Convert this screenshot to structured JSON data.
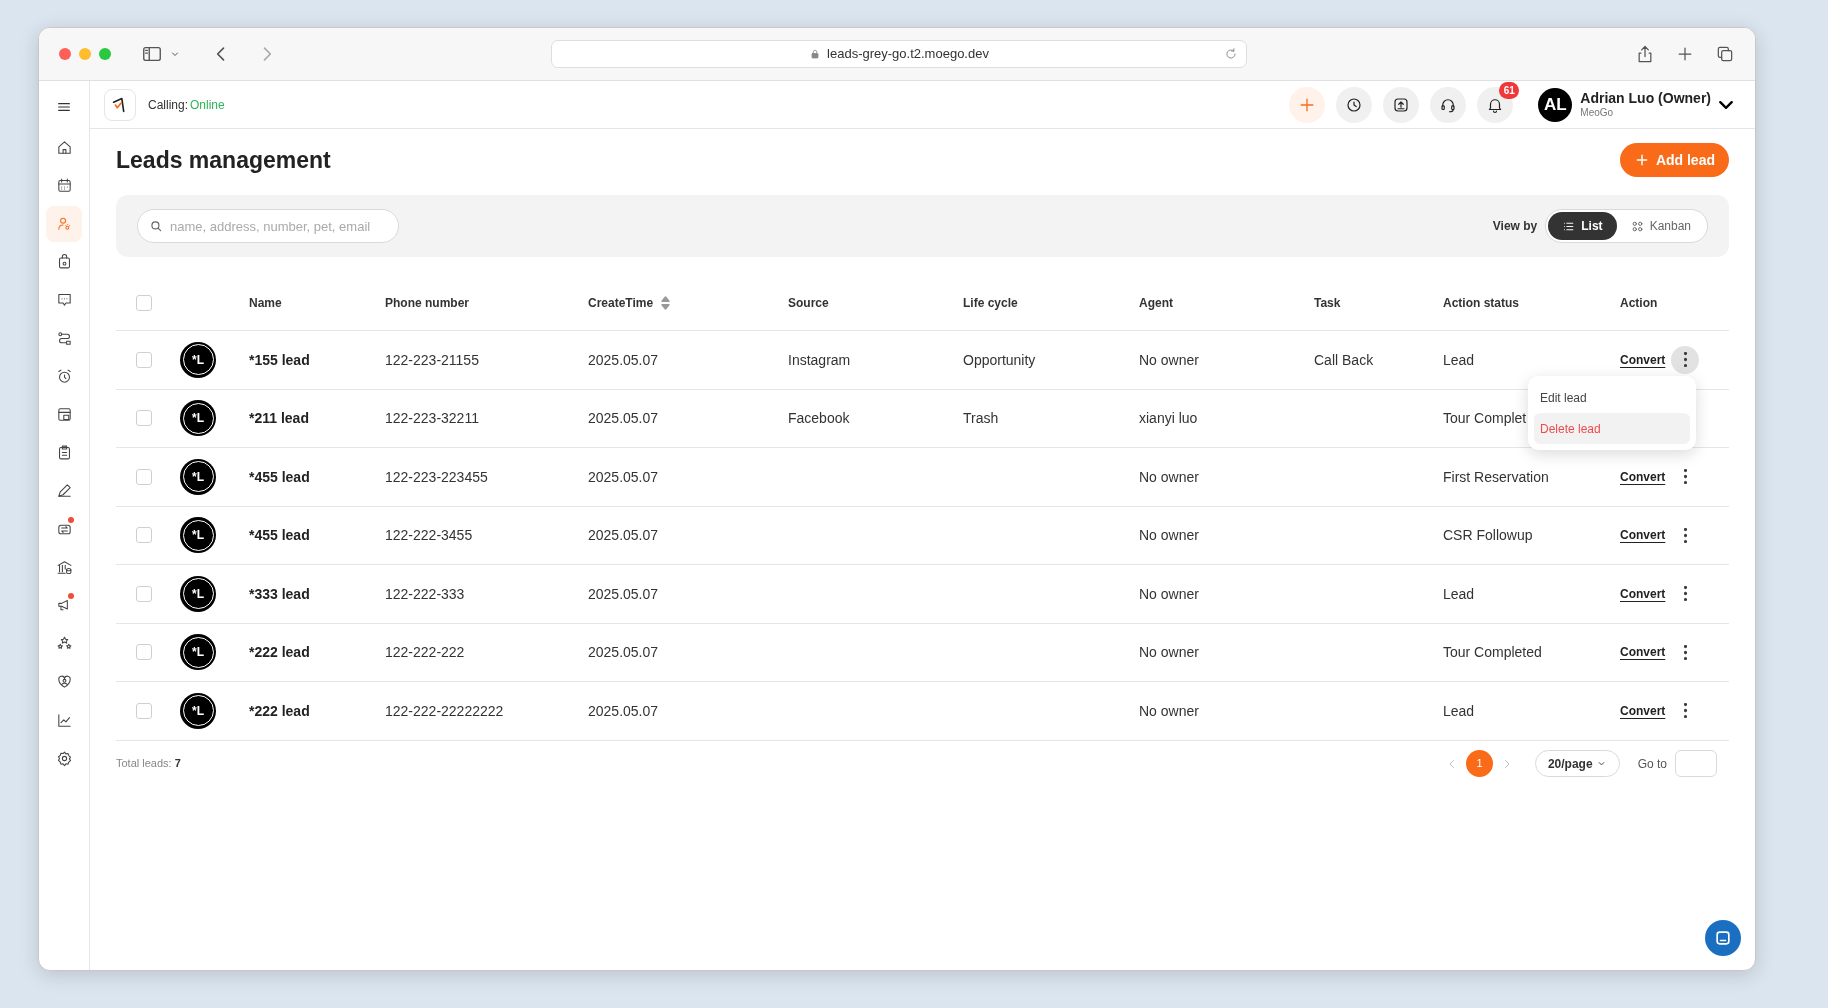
{
  "browser": {
    "url": "leads-grey-go.t2.moego.dev"
  },
  "topbar": {
    "calling_label": "Calling:",
    "calling_status": "Online",
    "notification_count": "61",
    "user": {
      "initials": "AL",
      "name": "Adrian Luo (Owner)",
      "company": "MeoGo"
    }
  },
  "sidebar": {
    "items": [
      {
        "selected": false,
        "dot": false
      },
      {
        "selected": false,
        "dot": false
      },
      {
        "selected": true,
        "dot": false
      },
      {
        "selected": false,
        "dot": false
      },
      {
        "selected": false,
        "dot": false
      },
      {
        "selected": false,
        "dot": false
      },
      {
        "selected": false,
        "dot": false
      },
      {
        "selected": false,
        "dot": false
      },
      {
        "selected": false,
        "dot": false
      },
      {
        "selected": false,
        "dot": false
      },
      {
        "selected": false,
        "dot": true
      },
      {
        "selected": false,
        "dot": false
      },
      {
        "selected": false,
        "dot": true
      },
      {
        "selected": false,
        "dot": false
      },
      {
        "selected": false,
        "dot": false
      },
      {
        "selected": false,
        "dot": false
      },
      {
        "selected": false,
        "dot": false
      }
    ]
  },
  "page": {
    "title": "Leads management",
    "add_button": "Add lead",
    "search": {
      "placeholder": "name, address, number, pet, email"
    },
    "view_by": {
      "label": "View by",
      "options": [
        {
          "label": "List",
          "selected": true
        },
        {
          "label": "Kanban",
          "selected": false
        }
      ]
    }
  },
  "table": {
    "select_all_checked": false,
    "columns": [
      {
        "label": "Name"
      },
      {
        "label": "Phone number"
      },
      {
        "label": "CreateTime",
        "sortable": true
      },
      {
        "label": "Source"
      },
      {
        "label": "Life cycle"
      },
      {
        "label": "Agent"
      },
      {
        "label": "Task"
      },
      {
        "label": "Action status"
      },
      {
        "label": "Action"
      }
    ],
    "rows": [
      {
        "checked": false,
        "avatar": "*L",
        "name": "*155 lead",
        "phone": "122-223-21155",
        "create_time": "2025.05.07",
        "source": "Instagram",
        "life_cycle": "Opportunity",
        "agent": "No owner",
        "task": "Call Back",
        "action_status": "Lead",
        "action": "Convert",
        "menu_open": true
      },
      {
        "checked": false,
        "avatar": "*L",
        "name": "*211 lead",
        "phone": "122-223-32211",
        "create_time": "2025.05.07",
        "source": "Facebook",
        "life_cycle": "Trash",
        "agent": "xianyi luo",
        "action_status": "Tour Complet"
      },
      {
        "checked": false,
        "avatar": "*L",
        "name": "*455 lead",
        "phone": "122-223-223455",
        "create_time": "2025.05.07",
        "agent": "No owner",
        "action_status": "First Reservation",
        "action": "Convert",
        "menu_open": false
      },
      {
        "checked": false,
        "avatar": "*L",
        "name": "*455 lead",
        "phone": "122-222-3455",
        "create_time": "2025.05.07",
        "agent": "No owner",
        "action_status": "CSR Followup",
        "action": "Convert",
        "menu_open": false
      },
      {
        "checked": false,
        "avatar": "*L",
        "name": "*333 lead",
        "phone": "122-222-333",
        "create_time": "2025.05.07",
        "agent": "No owner",
        "action_status": "Lead",
        "action": "Convert",
        "menu_open": false
      },
      {
        "checked": false,
        "avatar": "*L",
        "name": "*222 lead",
        "phone": "122-222-222",
        "create_time": "2025.05.07",
        "agent": "No owner",
        "action_status": "Tour Completed",
        "action": "Convert",
        "menu_open": false
      },
      {
        "checked": false,
        "avatar": "*L",
        "name": "*222 lead",
        "phone": "122-222-22222222",
        "create_time": "2025.05.07",
        "agent": "No owner",
        "action_status": "Lead",
        "action": "Convert",
        "menu_open": false
      }
    ]
  },
  "row_menu": {
    "items": [
      {
        "label": "Edit lead",
        "kind": "normal",
        "highlighted": false
      },
      {
        "label": "Delete lead",
        "kind": "danger",
        "highlighted": true
      }
    ]
  },
  "footer": {
    "total_label": "Total leads:",
    "total": "7",
    "pages": [
      {
        "label": "1",
        "selected": true
      }
    ],
    "page_size": "20/page",
    "goto_label": "Go to"
  }
}
